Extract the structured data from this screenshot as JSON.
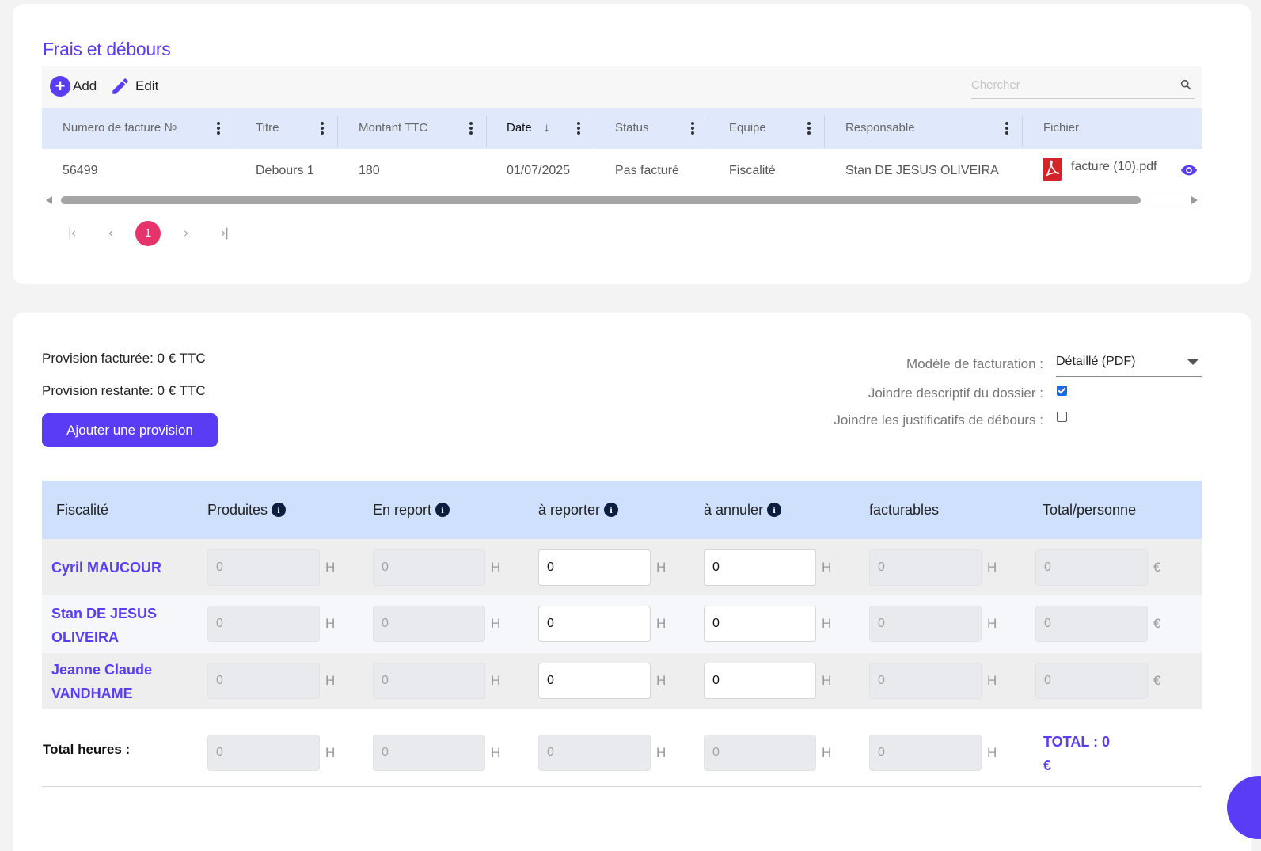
{
  "frais": {
    "title": "Frais et débours",
    "toolbar": {
      "add_label": "Add",
      "edit_label": "Edit",
      "search_placeholder": "Chercher"
    },
    "columns": [
      "Numero de facture №",
      "Titre",
      "Montant TTC",
      "Date",
      "Status",
      "Equipe",
      "Responsable",
      "Fichier"
    ],
    "sort_indicator": "↓",
    "rows": [
      {
        "numero": "56499",
        "titre": "Debours 1",
        "montant": "180",
        "date": "01/07/2025",
        "status": "Pas facturé",
        "equipe": "Fiscalité",
        "responsable": "Stan DE JESUS OLIVEIRA",
        "fichier": "facture (10).pdf"
      }
    ],
    "pagination": {
      "first": "|‹",
      "prev": "‹",
      "current": "1",
      "next": "›",
      "last": "›|"
    }
  },
  "provision": {
    "facturee": "Provision facturée: 0 € TTC",
    "restante": "Provision restante: 0 € TTC",
    "add_button": "Ajouter une provision",
    "modele_label": "Modèle de facturation :",
    "modele_value": "Détaillé (PDF)",
    "descriptif_label": "Joindre descriptif du dossier :",
    "descriptif_checked": true,
    "justificatifs_label": "Joindre les justificatifs de débours :",
    "justificatifs_checked": false
  },
  "hours_table": {
    "headers": [
      "Fiscalité",
      "Produites",
      "En report",
      "à reporter",
      "à annuler",
      "facturables",
      "Total/personne"
    ],
    "unit_h": "H",
    "unit_eur": "€",
    "rows": [
      {
        "name": "Cyril MAUCOUR",
        "values": [
          "0",
          "0",
          "0",
          "0",
          "0",
          "0"
        ]
      },
      {
        "name": "Stan DE JESUS OLIVEIRA",
        "values": [
          "0",
          "0",
          "0",
          "0",
          "0",
          "0"
        ]
      },
      {
        "name": "Jeanne Claude VANDHAME",
        "values": [
          "0",
          "0",
          "0",
          "0",
          "0",
          "0"
        ]
      }
    ],
    "total_label": "Total heures :",
    "totals": [
      "0",
      "0",
      "0",
      "0",
      "0"
    ],
    "grand_total": "TOTAL : 0 €"
  },
  "colors": {
    "accent": "#5b3cf5",
    "page_badge": "#e5336b",
    "header_bg": "#cfe0fc",
    "grid_header_bg": "#dfe9fb"
  }
}
